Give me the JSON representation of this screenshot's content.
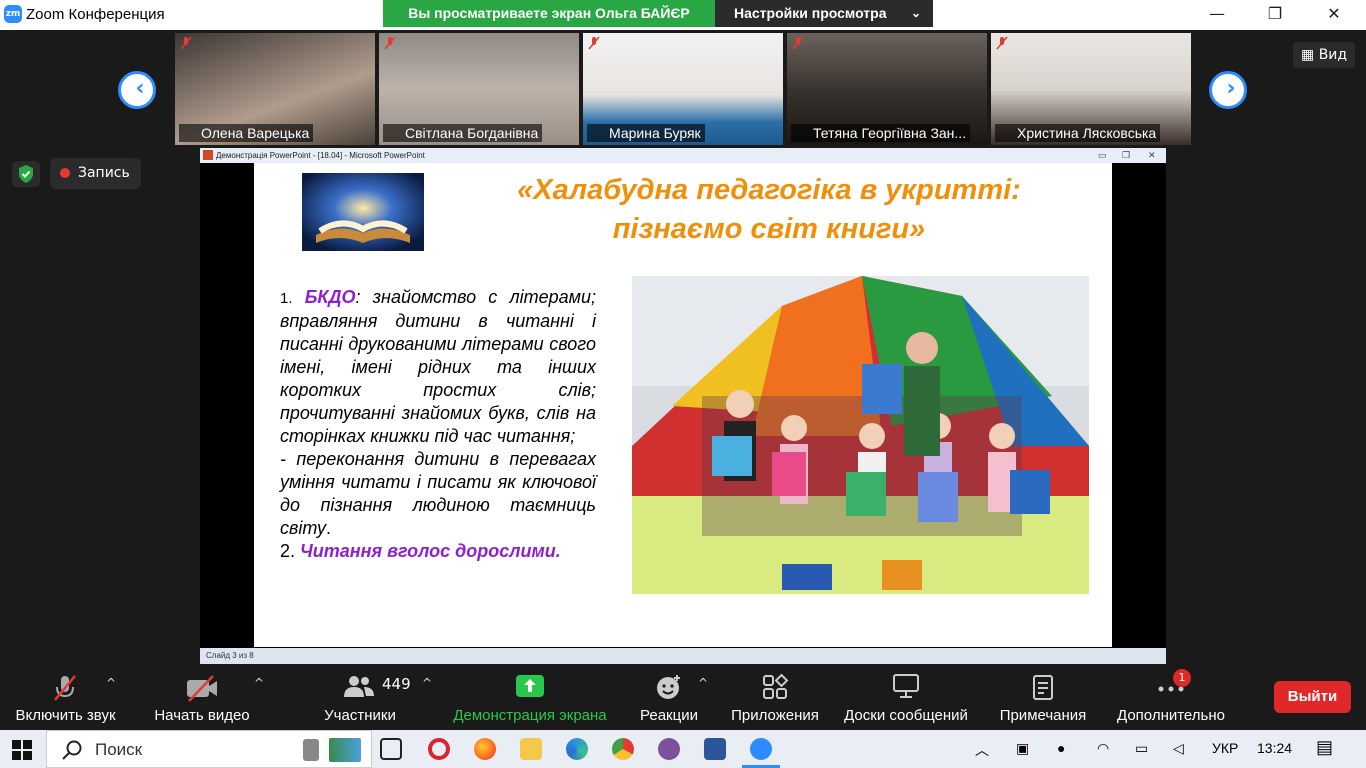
{
  "window": {
    "title": "Zoom Конференция",
    "logo_text": "zm"
  },
  "share_banner": {
    "text": "Вы просматриваете экран Ольга БАЙЄР",
    "view_settings": "Настройки просмотра"
  },
  "participants_strip": [
    {
      "name": "Олена Варецька"
    },
    {
      "name": "Світлана Богданівна"
    },
    {
      "name": "Марина Буряк"
    },
    {
      "name": "Тетяна Георгіївна Зан..."
    },
    {
      "name": "Христина Лясковська"
    }
  ],
  "view_button": "Вид",
  "record_label": "Запись",
  "ppt": {
    "window_title": "Демонстрація PowerPoint - [18.04] - Microsoft PowerPoint",
    "status": "Слайд 3 из 8",
    "slide": {
      "title_line1": "«Халабудна педагогіка в укритті:",
      "title_line2": "пізнаємо світ книги»",
      "item1_num": "1.",
      "item1_head": "БКДО",
      "item1_text": ": знайомство с літерами; вправляння дитини в читанні і писанні друкованими літерами свого імені, імені рідних та інших коротких простих слів; прочитуванні знайомих букв, слів на сторінках книжки під час читання;",
      "item1_text2": "- переконання дитини в перевагах уміння читати і писати як ключової до пізнання людиною таємниць світу",
      "item1_end": ".",
      "item2_num": "2.",
      "item2_text": "Читання вголос дорослими."
    }
  },
  "toolbar": {
    "audio": "Включить звук",
    "video": "Начать видео",
    "participants": "Участники",
    "participants_count": "449",
    "share": "Демонстрация экрана",
    "reactions": "Реакции",
    "apps": "Приложения",
    "whiteboards": "Доски сообщений",
    "notes": "Примечания",
    "more": "Дополнительно",
    "more_badge": "1",
    "exit": "Выйти"
  },
  "taskbar": {
    "search": "Поиск",
    "lang": "УКР",
    "time": "13:24"
  },
  "colors": {
    "zoom_blue": "#2d8cff",
    "share_green": "#29a744",
    "exit_red": "#e02828",
    "slide_title": "#f0900a",
    "slide_accent": "#8e1fd4"
  }
}
